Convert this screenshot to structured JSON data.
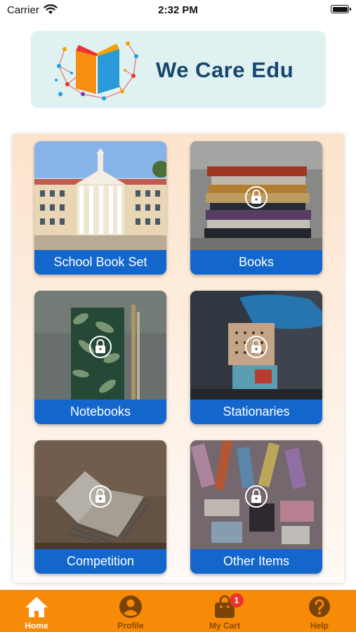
{
  "status_bar": {
    "carrier": "Carrier",
    "time": "2:32 PM"
  },
  "brand": {
    "name": "We Care Edu"
  },
  "categories": [
    {
      "label": "School Book Set",
      "locked": false
    },
    {
      "label": "Books",
      "locked": true
    },
    {
      "label": "Notebooks",
      "locked": true
    },
    {
      "label": "Stationaries",
      "locked": true
    },
    {
      "label": "Competition",
      "locked": true
    },
    {
      "label": "Other Items",
      "locked": true
    }
  ],
  "tabbar": {
    "items": [
      {
        "label": "Home",
        "icon": "home-icon",
        "active": true
      },
      {
        "label": "Profile",
        "icon": "person-icon",
        "active": false
      },
      {
        "label": "My Cart",
        "icon": "cart-icon",
        "active": false,
        "badge": "1"
      },
      {
        "label": "Help",
        "icon": "help-icon",
        "active": false
      }
    ]
  },
  "colors": {
    "accent": "#f78a06",
    "tile_label": "#1367cc",
    "brand_text": "#17466f",
    "badge": "#e8342a"
  }
}
